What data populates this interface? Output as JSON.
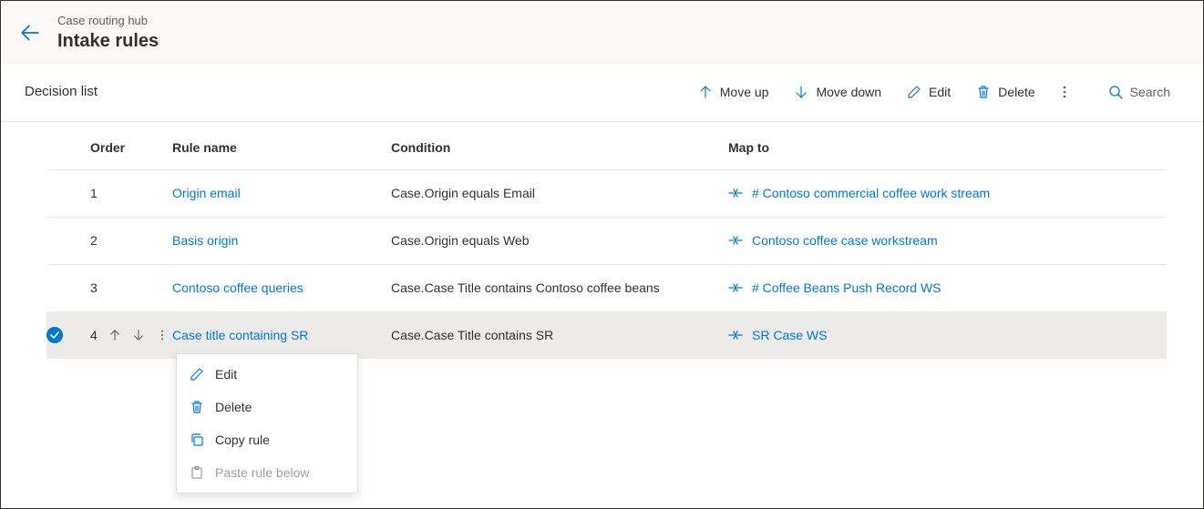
{
  "header": {
    "breadcrumb": "Case routing hub",
    "title": "Intake rules"
  },
  "section": {
    "heading": "Decision list"
  },
  "commands": {
    "move_up": "Move up",
    "move_down": "Move down",
    "edit": "Edit",
    "delete": "Delete",
    "search": "Search"
  },
  "columns": {
    "order": "Order",
    "rule_name": "Rule name",
    "condition": "Condition",
    "map_to": "Map to"
  },
  "rows": [
    {
      "order": "1",
      "rule": "Origin email",
      "condition": "Case.Origin equals Email",
      "mapto": "# Contoso commercial coffee work stream"
    },
    {
      "order": "2",
      "rule": "Basis origin",
      "condition": "Case.Origin equals Web",
      "mapto": "Contoso coffee case workstream"
    },
    {
      "order": "3",
      "rule": "Contoso coffee queries",
      "condition": "Case.Case Title contains Contoso coffee beans",
      "mapto": "# Coffee Beans Push Record WS"
    },
    {
      "order": "4",
      "rule": "Case title containing SR",
      "condition": "Case.Case Title contains SR",
      "mapto": "SR Case WS"
    }
  ],
  "context_menu": {
    "edit": "Edit",
    "delete": "Delete",
    "copy": "Copy rule",
    "paste": "Paste rule below"
  }
}
